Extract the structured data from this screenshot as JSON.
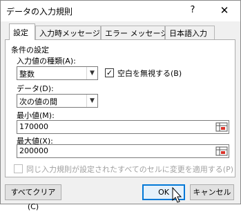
{
  "window": {
    "title": "データの入力規則",
    "help_glyph": "?",
    "close_glyph": "✕"
  },
  "tabs": [
    {
      "label": "設定",
      "active": true
    },
    {
      "label": "入力時メッセージ",
      "active": false
    },
    {
      "label": "エラー メッセージ",
      "active": false
    },
    {
      "label": "日本語入力",
      "active": false
    }
  ],
  "settings": {
    "group_label": "条件の設定",
    "allow_label": "入力値の種類(A):",
    "allow_value": "整数",
    "ignore_blank_label": "空白を無視する(B)",
    "ignore_blank_checked": true,
    "data_label": "データ(D):",
    "data_value": "次の値の間",
    "min_label": "最小値(M):",
    "min_value": "170000",
    "max_label": "最大値(X):",
    "max_value": "200000",
    "apply_all_label": "同じ入力規則が設定されたすべてのセルに変更を適用する(P)",
    "apply_all_checked": false,
    "apply_all_enabled": false
  },
  "buttons": {
    "clear_all": "すべてクリア(C)",
    "ok": "OK",
    "cancel": "キャンセル"
  },
  "icons": {
    "check_glyph": "✓",
    "dropdown_glyph": "▼"
  },
  "colors": {
    "default_button_border": "#0078d7",
    "background": "#f0f0f0"
  }
}
